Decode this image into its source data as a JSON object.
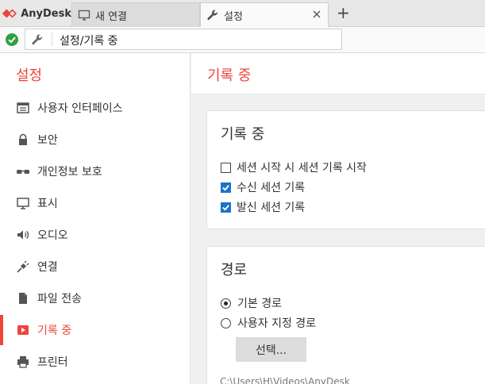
{
  "app": {
    "brand_name": "AnyDesk",
    "accent_color": "#ef443b"
  },
  "tabs": [
    {
      "label": "새 연결",
      "icon": "monitor-icon"
    },
    {
      "label": "설정",
      "icon": "wrench-icon"
    }
  ],
  "address_bar": {
    "status_icon": "check-circle-icon",
    "text": "설정/기록 중"
  },
  "sidebar": {
    "title": "설정",
    "items": [
      {
        "label": "사용자 인터페이스",
        "icon": "window-icon"
      },
      {
        "label": "보안",
        "icon": "lock-icon"
      },
      {
        "label": "개인정보 보호",
        "icon": "glasses-icon"
      },
      {
        "label": "표시",
        "icon": "monitor-icon"
      },
      {
        "label": "오디오",
        "icon": "speaker-icon"
      },
      {
        "label": "연결",
        "icon": "plug-icon"
      },
      {
        "label": "파일 전송",
        "icon": "file-icon"
      },
      {
        "label": "기록 중",
        "icon": "record-icon",
        "active": true
      },
      {
        "label": "프린터",
        "icon": "printer-icon"
      }
    ]
  },
  "main": {
    "title": "기록 중",
    "recording": {
      "title": "기록 중",
      "options": [
        {
          "label": "세션 시작 시 세션 기록 시작",
          "checked": false
        },
        {
          "label": "수신 세션 기록",
          "checked": true
        },
        {
          "label": "발신 세션 기록",
          "checked": true
        }
      ]
    },
    "path": {
      "title": "경로",
      "options": [
        {
          "label": "기본 경로",
          "selected": true
        },
        {
          "label": "사용자 지정 경로",
          "selected": false
        }
      ],
      "select_button": "선택...",
      "current_path": "C:\\Users\\H\\Videos\\AnyDesk"
    }
  }
}
